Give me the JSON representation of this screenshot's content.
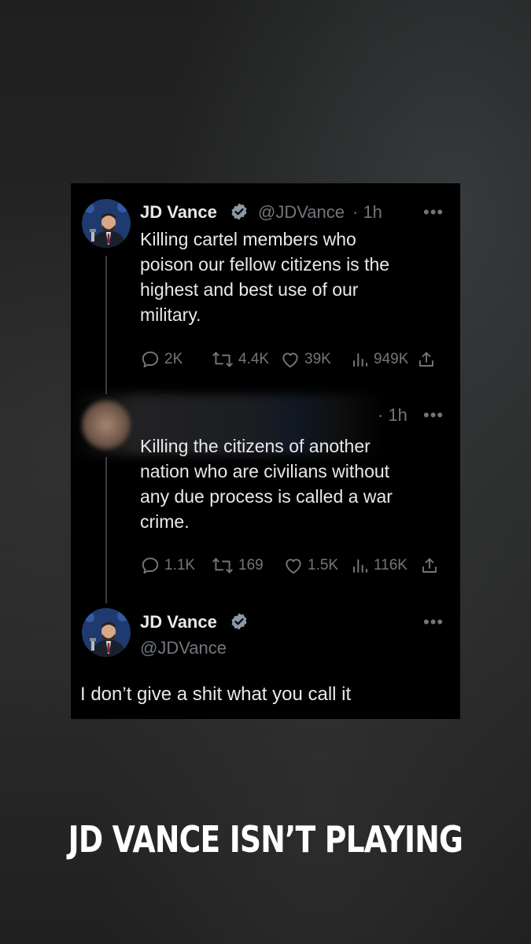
{
  "tweets": [
    {
      "name": "JD Vance",
      "handle": "@JDVance",
      "time": "· 1h",
      "text": "Killing cartel members who\npoison our fellow citizens is the\nhighest and best use of our\nmilitary.",
      "stats": {
        "replies": "2K",
        "reposts": "4.4K",
        "likes": "39K",
        "views": "949K"
      }
    },
    {
      "time": "· 1h",
      "text": "Killing the citizens of another\nnation who are civilians without\nany due process is called a war\ncrime.",
      "stats": {
        "replies": "1.1K",
        "reposts": "169",
        "likes": "1.5K",
        "views": "116K"
      }
    },
    {
      "name": "JD Vance",
      "handle": "@JDVance",
      "text": "I don’t give a shit what you call it"
    }
  ],
  "icons": {
    "more": "more-dots-icon",
    "verified": "verified-badge-icon",
    "reply": "reply-icon",
    "repost": "repost-icon",
    "like": "like-icon",
    "views": "views-icon",
    "share": "share-icon"
  },
  "colors": {
    "background": "#222222",
    "card": "#000000",
    "text": "#e7e9ea",
    "muted": "#71767b",
    "verified": "#1d9bf0"
  },
  "caption": "JD VANCE ISN’T PLAYING"
}
